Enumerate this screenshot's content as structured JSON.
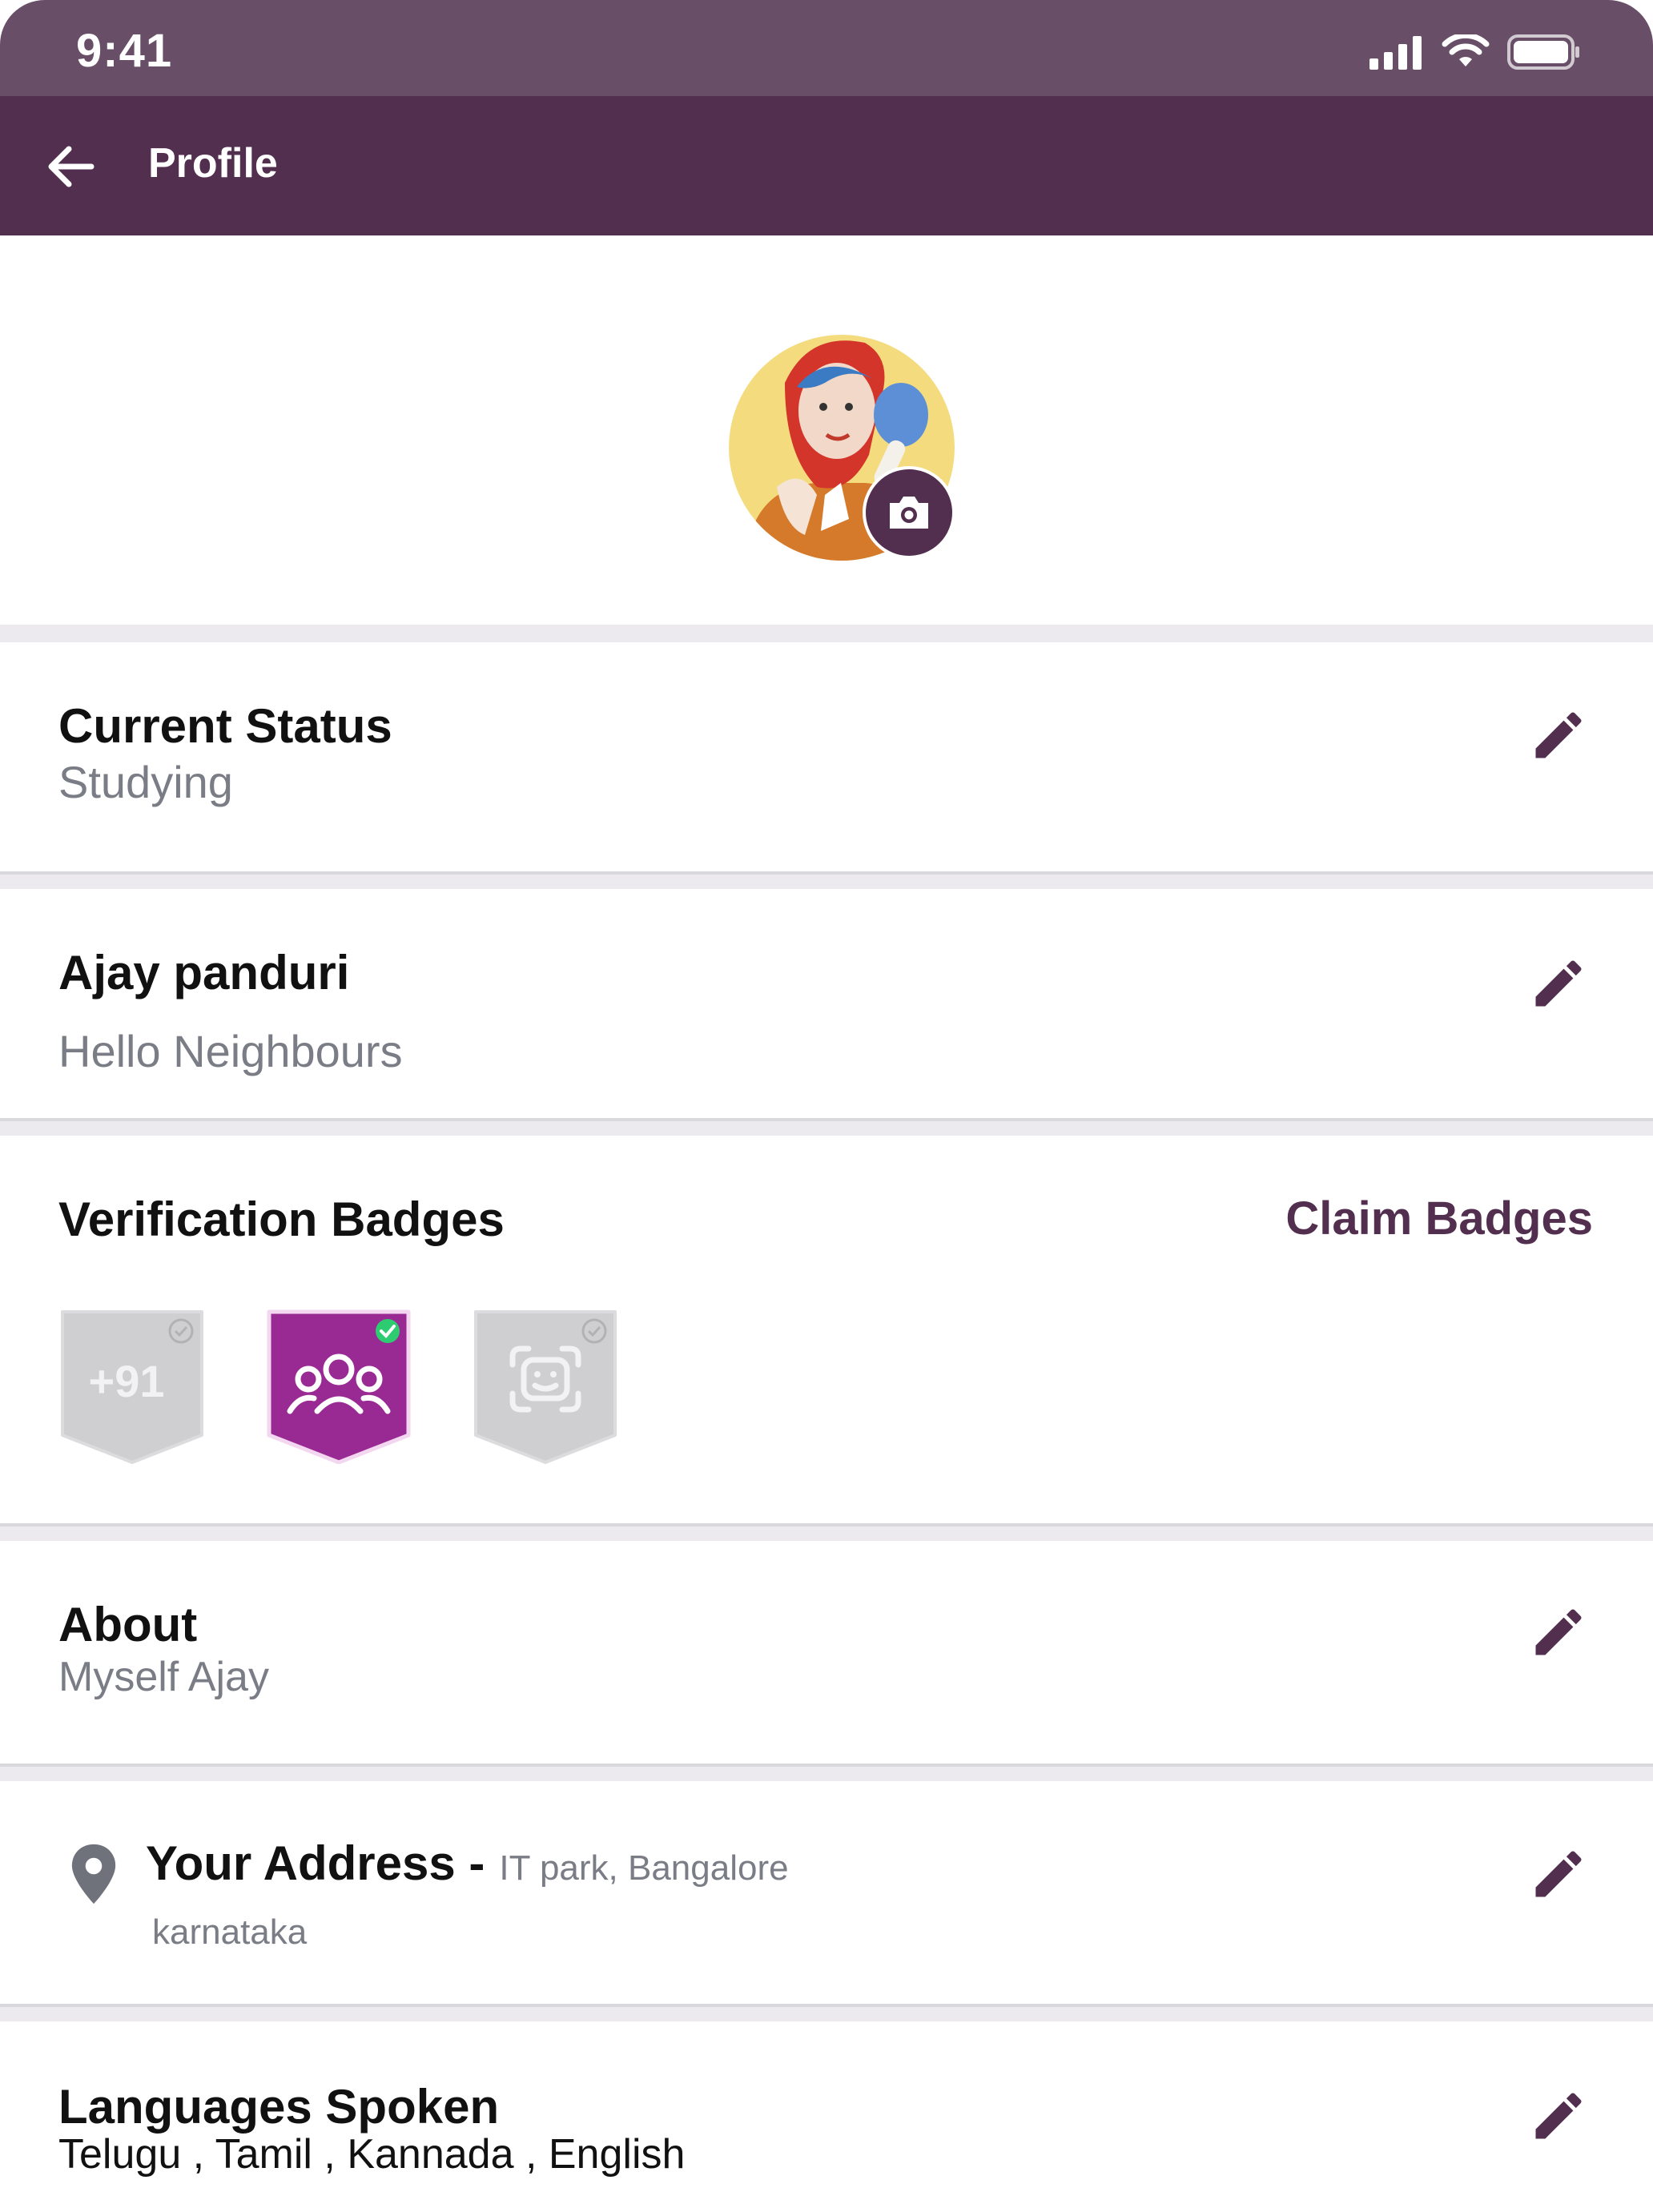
{
  "status_bar": {
    "time": "9:41",
    "icons": [
      "signal-icon",
      "wifi-icon",
      "battery-icon"
    ]
  },
  "app_bar": {
    "back_icon": "arrow-left-icon",
    "title": "Profile"
  },
  "avatar": {
    "camera_icon": "camera-icon"
  },
  "current_status": {
    "title": "Current Status",
    "value": "Studying"
  },
  "name_section": {
    "name": "Ajay panduri",
    "bio": "Hello Neighbours"
  },
  "verification": {
    "title": "Verification Badges",
    "claim_label": "Claim Badges",
    "badges": [
      {
        "label": "+91",
        "icon": "phone-badge-icon",
        "verified": false
      },
      {
        "label": "",
        "icon": "community-badge-icon",
        "verified": true
      },
      {
        "label": "",
        "icon": "face-id-badge-icon",
        "verified": false
      }
    ]
  },
  "about": {
    "title": "About",
    "value": "Myself Ajay"
  },
  "address": {
    "title": "Your Address -",
    "value": "IT park, Bangalore",
    "state": "karnataka",
    "icon": "location-pin-icon"
  },
  "languages": {
    "title": "Languages Spoken",
    "value": "Telugu , Tamil , Kannada , English"
  },
  "colors": {
    "status_bar": "#684e67",
    "app_bar": "#522e4f",
    "accent": "#522e4f",
    "badge_active": "#9a2a93",
    "badge_inactive": "#cfcfd1",
    "verified_check": "#2ecc71",
    "muted_text": "#7a7d85"
  }
}
